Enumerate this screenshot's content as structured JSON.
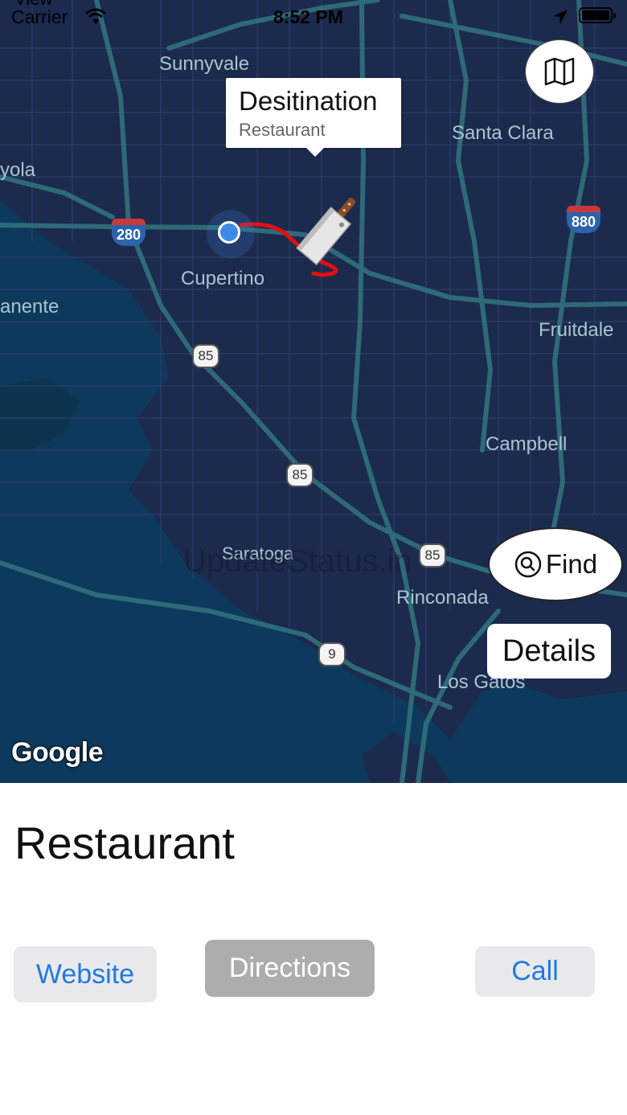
{
  "status_bar": {
    "back_label": "View",
    "carrier": "Carrier",
    "time": "8:52 PM",
    "icons": [
      "wifi-icon",
      "location-arrow-icon",
      "battery-icon"
    ]
  },
  "map": {
    "places": {
      "sunnyvale": "Sunnyvale",
      "santa_clara": "Santa Clara",
      "los_altos_partial": "yola",
      "cupertino": "Cupertino",
      "permanente_partial": "anente",
      "fruitdale": "Fruitdale",
      "campbell": "Campbell",
      "saratoga": "Saratoga",
      "rinconada": "Rinconada",
      "los_gatos": "Los Gatos"
    },
    "shields": {
      "i280": "280",
      "i880": "880",
      "sr85_a": "85",
      "sr85_b": "85",
      "sr85_c": "85",
      "sr9": "9"
    },
    "callout": {
      "title": "Desitination",
      "subtitle": "Restaurant"
    },
    "map_type_icon": "map-icon",
    "destination_marker_icon": "cleaver-knife-icon",
    "route_color": "#e01010",
    "find_icon": "search-icon",
    "find_label": "Find",
    "details_label": "Details",
    "provider_logo": "Google",
    "watermark": "UpdateStatus.in"
  },
  "panel": {
    "title": "Restaurant",
    "website_label": "Website",
    "directions_label": "Directions",
    "call_label": "Call"
  },
  "colors": {
    "map_land": "#1c2a4e",
    "map_water": "#0d3a5c",
    "roads": "#2e6a78",
    "accent_blue": "#1f7ae0",
    "button_gray": "#e9e9ec",
    "directions_gray": "#adadad"
  }
}
